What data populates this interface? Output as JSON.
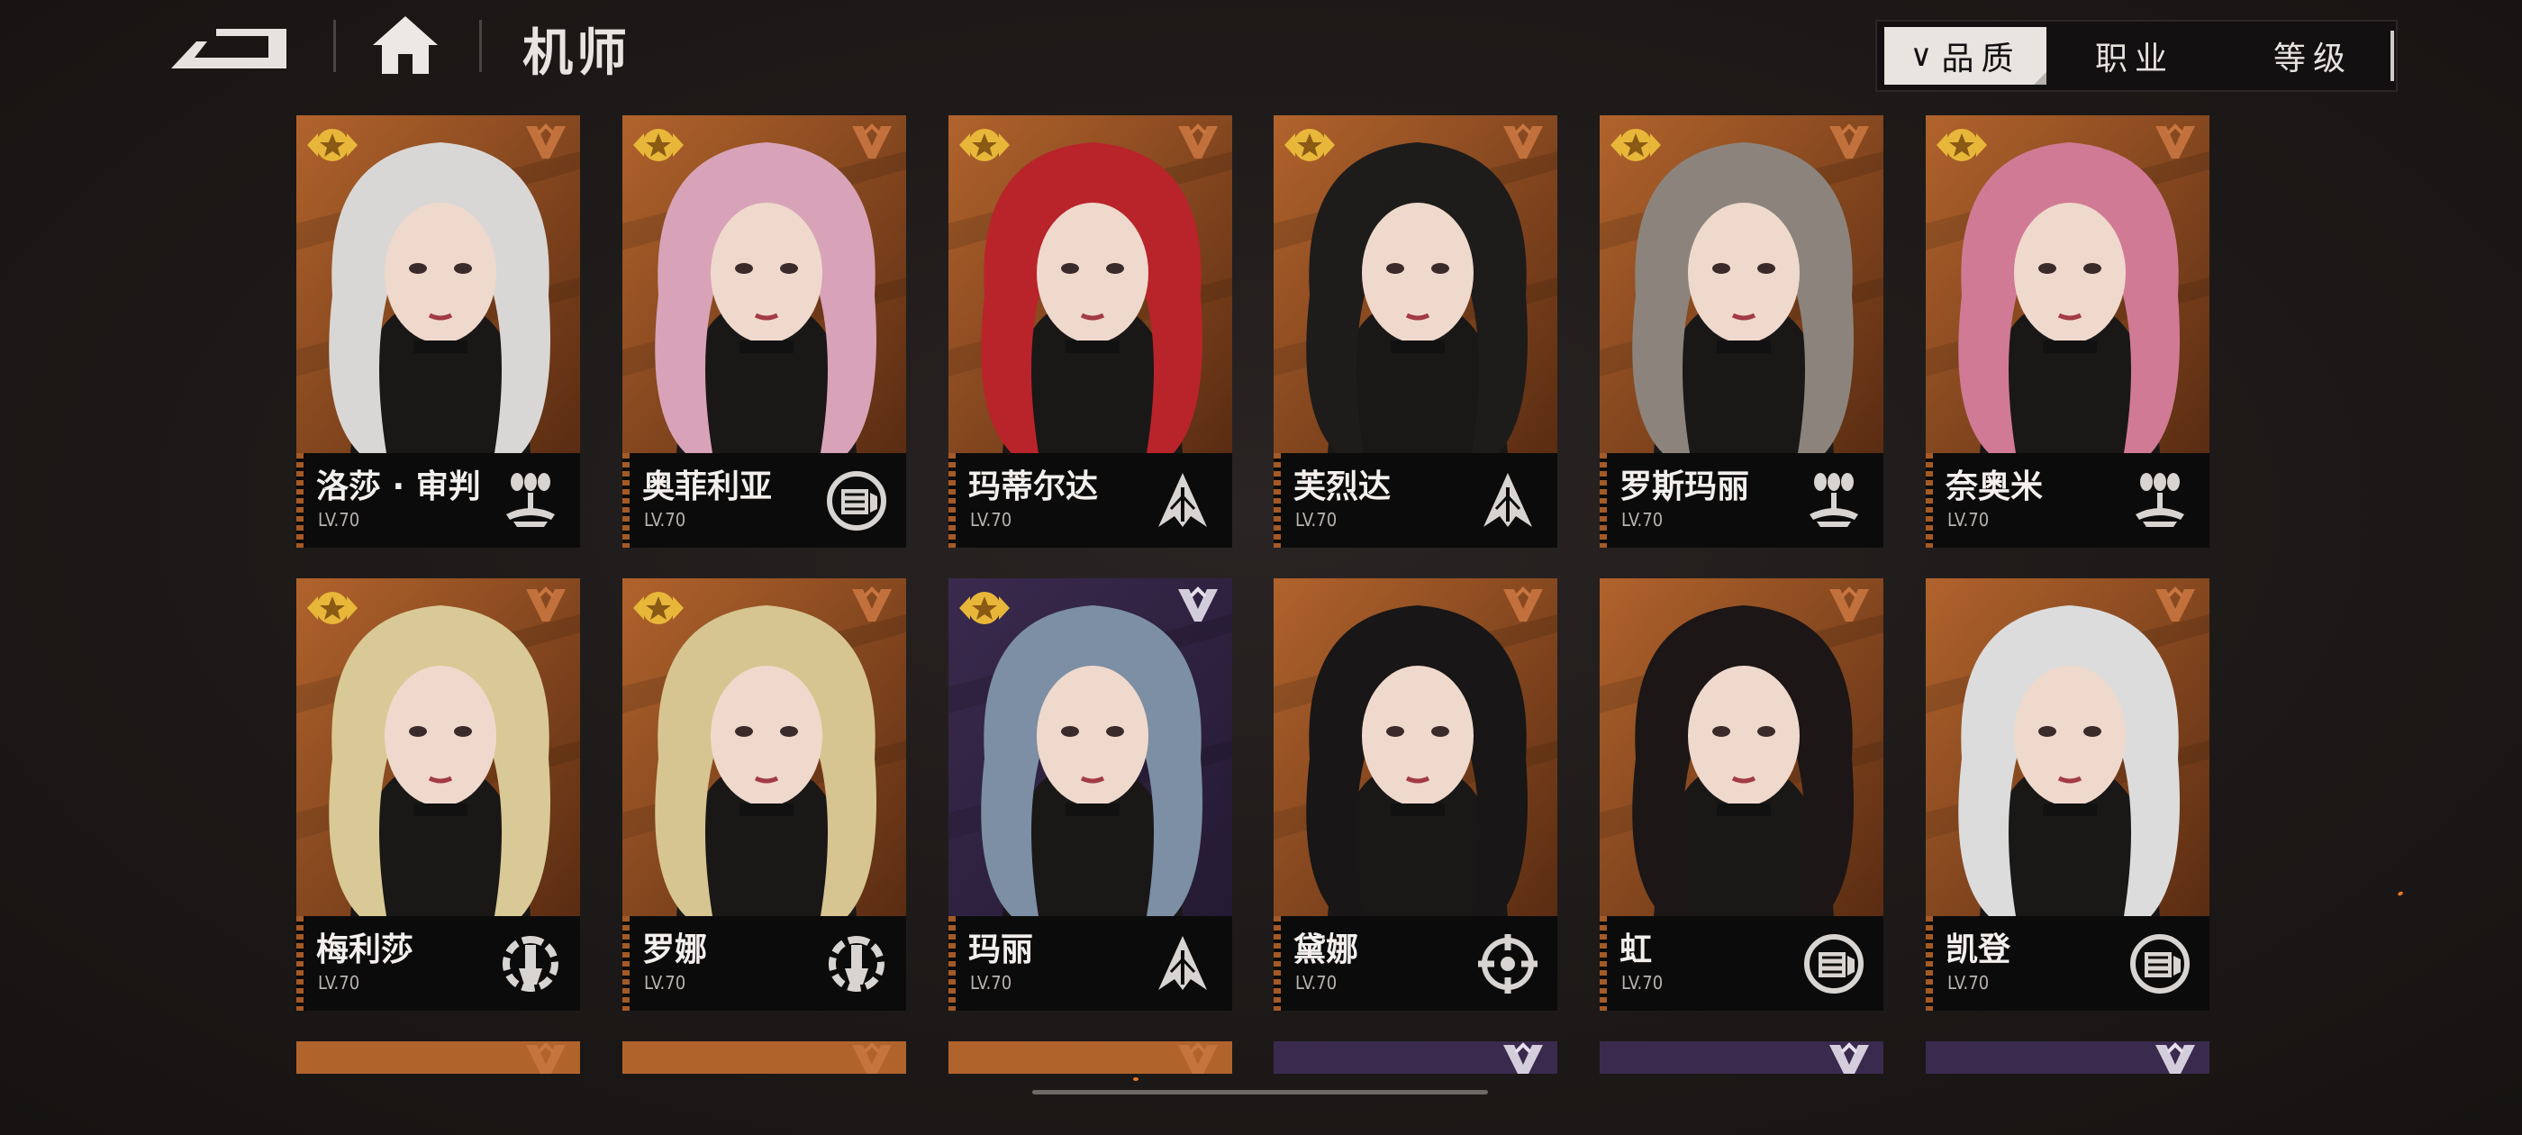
{
  "topbar": {
    "title": "机师",
    "back_icon": "back-arrow-icon",
    "home_icon": "home-icon"
  },
  "sort": {
    "tabs": [
      {
        "label": "品质",
        "active": true
      },
      {
        "label": "职业",
        "active": false
      },
      {
        "label": "等级",
        "active": false
      }
    ]
  },
  "colors": {
    "card_orange": "#b1632c",
    "card_purple": "#3a2a4e",
    "plate": "#0c0b0b",
    "star_gold": "#e8b73a"
  },
  "pilots": [
    {
      "name": "洛莎 · 审判",
      "level": "LV.70",
      "class_icon": "bombard-icon",
      "star": true,
      "bg": "orange"
    },
    {
      "name": "奥菲利亚",
      "level": "LV.70",
      "class_icon": "shield-icon",
      "star": true,
      "bg": "orange"
    },
    {
      "name": "玛蒂尔达",
      "level": "LV.70",
      "class_icon": "assault-icon",
      "star": true,
      "bg": "orange"
    },
    {
      "name": "芙烈达",
      "level": "LV.70",
      "class_icon": "assault-icon",
      "star": true,
      "bg": "orange"
    },
    {
      "name": "罗斯玛丽",
      "level": "LV.70",
      "class_icon": "bombard-icon",
      "star": true,
      "bg": "orange"
    },
    {
      "name": "奈奥米",
      "level": "LV.70",
      "class_icon": "bombard-icon",
      "star": true,
      "bg": "orange"
    },
    {
      "name": "梅利莎",
      "level": "LV.70",
      "class_icon": "wrench-icon",
      "star": true,
      "bg": "orange"
    },
    {
      "name": "罗娜",
      "level": "LV.70",
      "class_icon": "wrench-icon",
      "star": true,
      "bg": "orange"
    },
    {
      "name": "玛丽",
      "level": "LV.70",
      "class_icon": "assault-icon",
      "star": true,
      "bg": "purple"
    },
    {
      "name": "黛娜",
      "level": "LV.70",
      "class_icon": "target-icon",
      "star": false,
      "bg": "orange"
    },
    {
      "name": "虹",
      "level": "LV.70",
      "class_icon": "shield-icon",
      "star": false,
      "bg": "orange"
    },
    {
      "name": "凯登",
      "level": "LV.70",
      "class_icon": "shield-icon",
      "star": false,
      "bg": "orange"
    }
  ],
  "partial_row": {
    "count": 6,
    "bgs": [
      "orange",
      "orange",
      "orange",
      "purple",
      "purple",
      "purple"
    ]
  }
}
